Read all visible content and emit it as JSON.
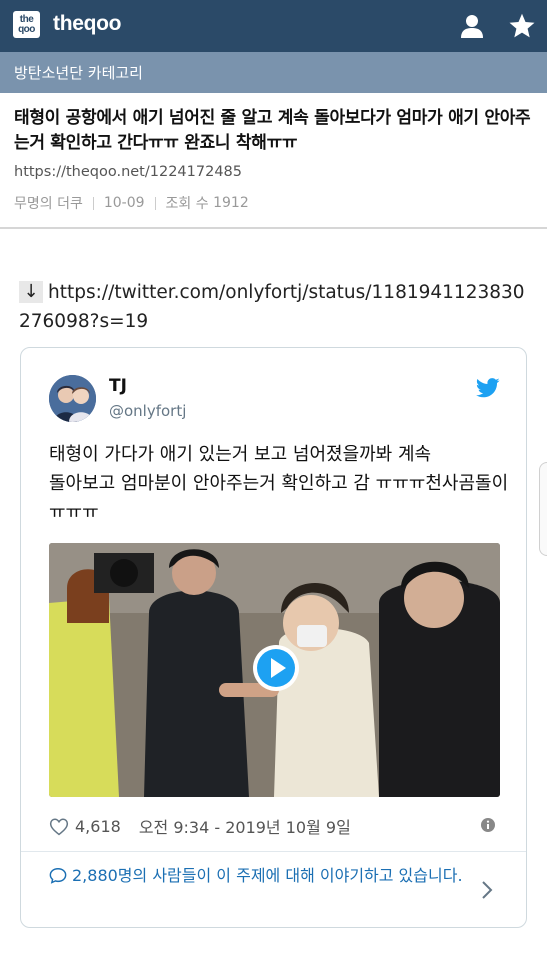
{
  "header": {
    "logo_top": "the",
    "logo_bottom": "qoo",
    "brand": "theqoo",
    "icons": [
      "user-icon",
      "star-icon"
    ],
    "bg_color": "#2b4a68"
  },
  "category": {
    "label": "방탄소년단 카테고리",
    "bg_color": "#7a93ad"
  },
  "post": {
    "title": "태형이 공항에서 애기 넘어진 줄 알고 계속 돌아보다가 엄마가 애기 안아주는거 확인하고 간다ㅠㅠ 완죠니 착해ㅠㅠ",
    "url": "https://theqoo.net/1224172485",
    "author": "무명의 더쿠",
    "date": "10-09",
    "views_label": "조회 수",
    "views": "1912"
  },
  "body": {
    "arrow": "↓",
    "link": "https://twitter.com/onlyfortj/status/1181941123830276098?s=19"
  },
  "tweet": {
    "name": "TJ",
    "handle": "@onlyfortj",
    "text": "태형이 가다가 애기 있는거 보고 넘어졌을까봐 계속\n 돌아보고 엄마분이 안아주는거 확인하고 감 ㅠㅠㅠ천사곰돌이ㅠㅠㅠ",
    "likes": "4,618",
    "timestamp": "오전 9:34 - 2019년 10월 9일",
    "conversation": "2,880명의 사람들이 이 주제에 대해 이야기하고 있습니다.",
    "accent_color": "#1da1f2",
    "link_color": "#1b6fb3"
  }
}
